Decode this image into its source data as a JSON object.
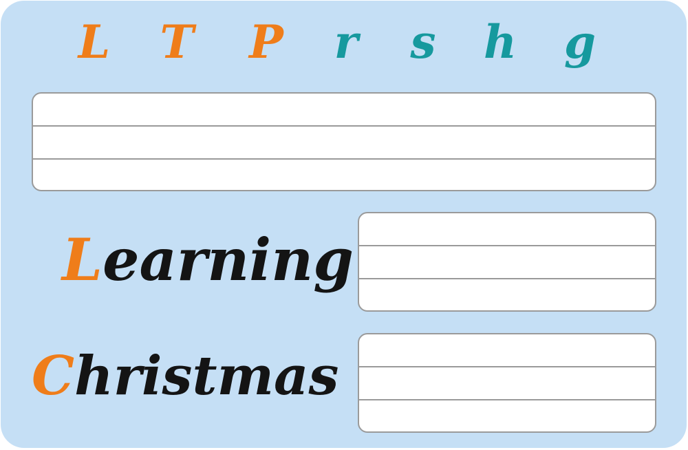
{
  "alphabet": {
    "letters": [
      {
        "char": "L",
        "color": "#ef7d1a"
      },
      {
        "char": "T",
        "color": "#ef7d1a"
      },
      {
        "char": "P",
        "color": "#ef7d1a"
      },
      {
        "char": "r",
        "color": "#16999e"
      },
      {
        "char": "s",
        "color": "#16999e"
      },
      {
        "char": "h",
        "color": "#16999e"
      },
      {
        "char": "g",
        "color": "#16999e"
      }
    ]
  },
  "words": [
    {
      "first": "L",
      "rest": "earning"
    },
    {
      "first": "C",
      "rest": "hristmas"
    }
  ],
  "colors": {
    "background": "#c5dff5",
    "accent_orange": "#ef7d1a",
    "accent_teal": "#16999e",
    "ink": "#141414",
    "line": "#9a9a9a"
  }
}
